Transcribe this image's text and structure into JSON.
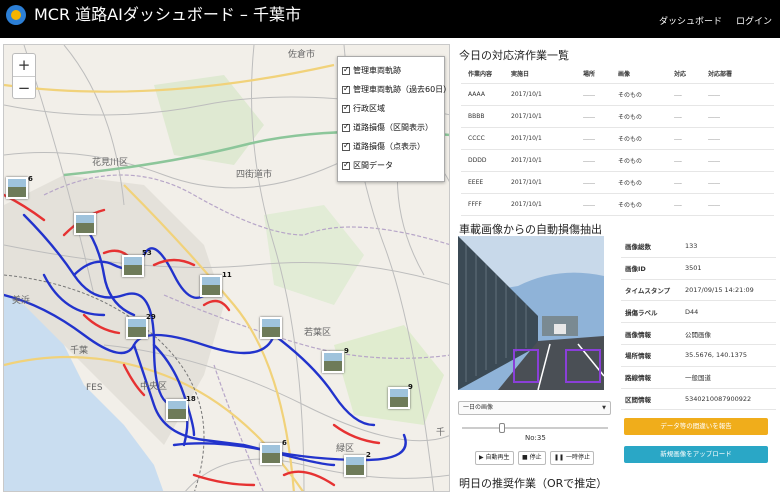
{
  "header": {
    "title": "MCR 道路AIダッシュボード – 千葉市",
    "nav": [
      "ダッシュボード",
      "ログイン"
    ]
  },
  "map": {
    "zoom_in": "+",
    "zoom_out": "−",
    "layers": [
      "管理車両軌跡",
      "管理車両軌跡（過去60日）",
      "行政区域",
      "道路損傷（区間表示）",
      "道路損傷（点表示）",
      "区間データ"
    ],
    "places": [
      "佐倉市",
      "花見川区",
      "四街道市",
      "若葉区",
      "美浜",
      "千葉",
      "中央区",
      "緑区",
      "FES",
      "千"
    ],
    "markers": [
      "6",
      "53",
      "11",
      "29",
      "18",
      "9",
      "9",
      "6",
      "2"
    ]
  },
  "work_list": {
    "title": "今日の対応済作業一覧",
    "columns": [
      "作業内容",
      "実施日",
      "場所",
      "画像",
      "対応",
      "対応部署"
    ],
    "rows": [
      [
        "AAAA",
        "2017/10/1",
        "……",
        "そのもの",
        "….",
        "……"
      ],
      [
        "BBBB",
        "2017/10/1",
        "……",
        "そのもの",
        "….",
        "……"
      ],
      [
        "CCCC",
        "2017/10/1",
        "……",
        "そのもの",
        "….",
        "……"
      ],
      [
        "DDDD",
        "2017/10/1",
        "……",
        "そのもの",
        "….",
        "……"
      ],
      [
        "EEEE",
        "2017/10/1",
        "……",
        "そのもの",
        "….",
        "……"
      ],
      [
        "FFFF",
        "2017/10/1",
        "……",
        "そのもの",
        "….",
        "……"
      ]
    ]
  },
  "damage": {
    "title": "車載画像からの自動損傷抽出",
    "select_label": "一日の画像",
    "slider_label": "No:35",
    "slider_fraction": 0.25,
    "controls": [
      "▶ 自動再生",
      "■ 停止",
      "❚❚ 一時停止"
    ],
    "props": [
      [
        "画像総数",
        "133"
      ],
      [
        "画像ID",
        "3501"
      ],
      [
        "タイムスタンプ",
        "2017/09/15 14:21:09"
      ],
      [
        "損傷ラベル",
        "D44"
      ],
      [
        "画像情報",
        "公開画像"
      ],
      [
        "場所情報",
        "35.5676, 140.1375"
      ],
      [
        "路線情報",
        "一般国道"
      ],
      [
        "区間情報",
        "5340210087900922"
      ]
    ],
    "report_button": "データ等の間違いを報告",
    "upload_button": "新規画像をアップロード"
  },
  "recommend": {
    "title": "明日の推奨作業（ORで推定）"
  }
}
